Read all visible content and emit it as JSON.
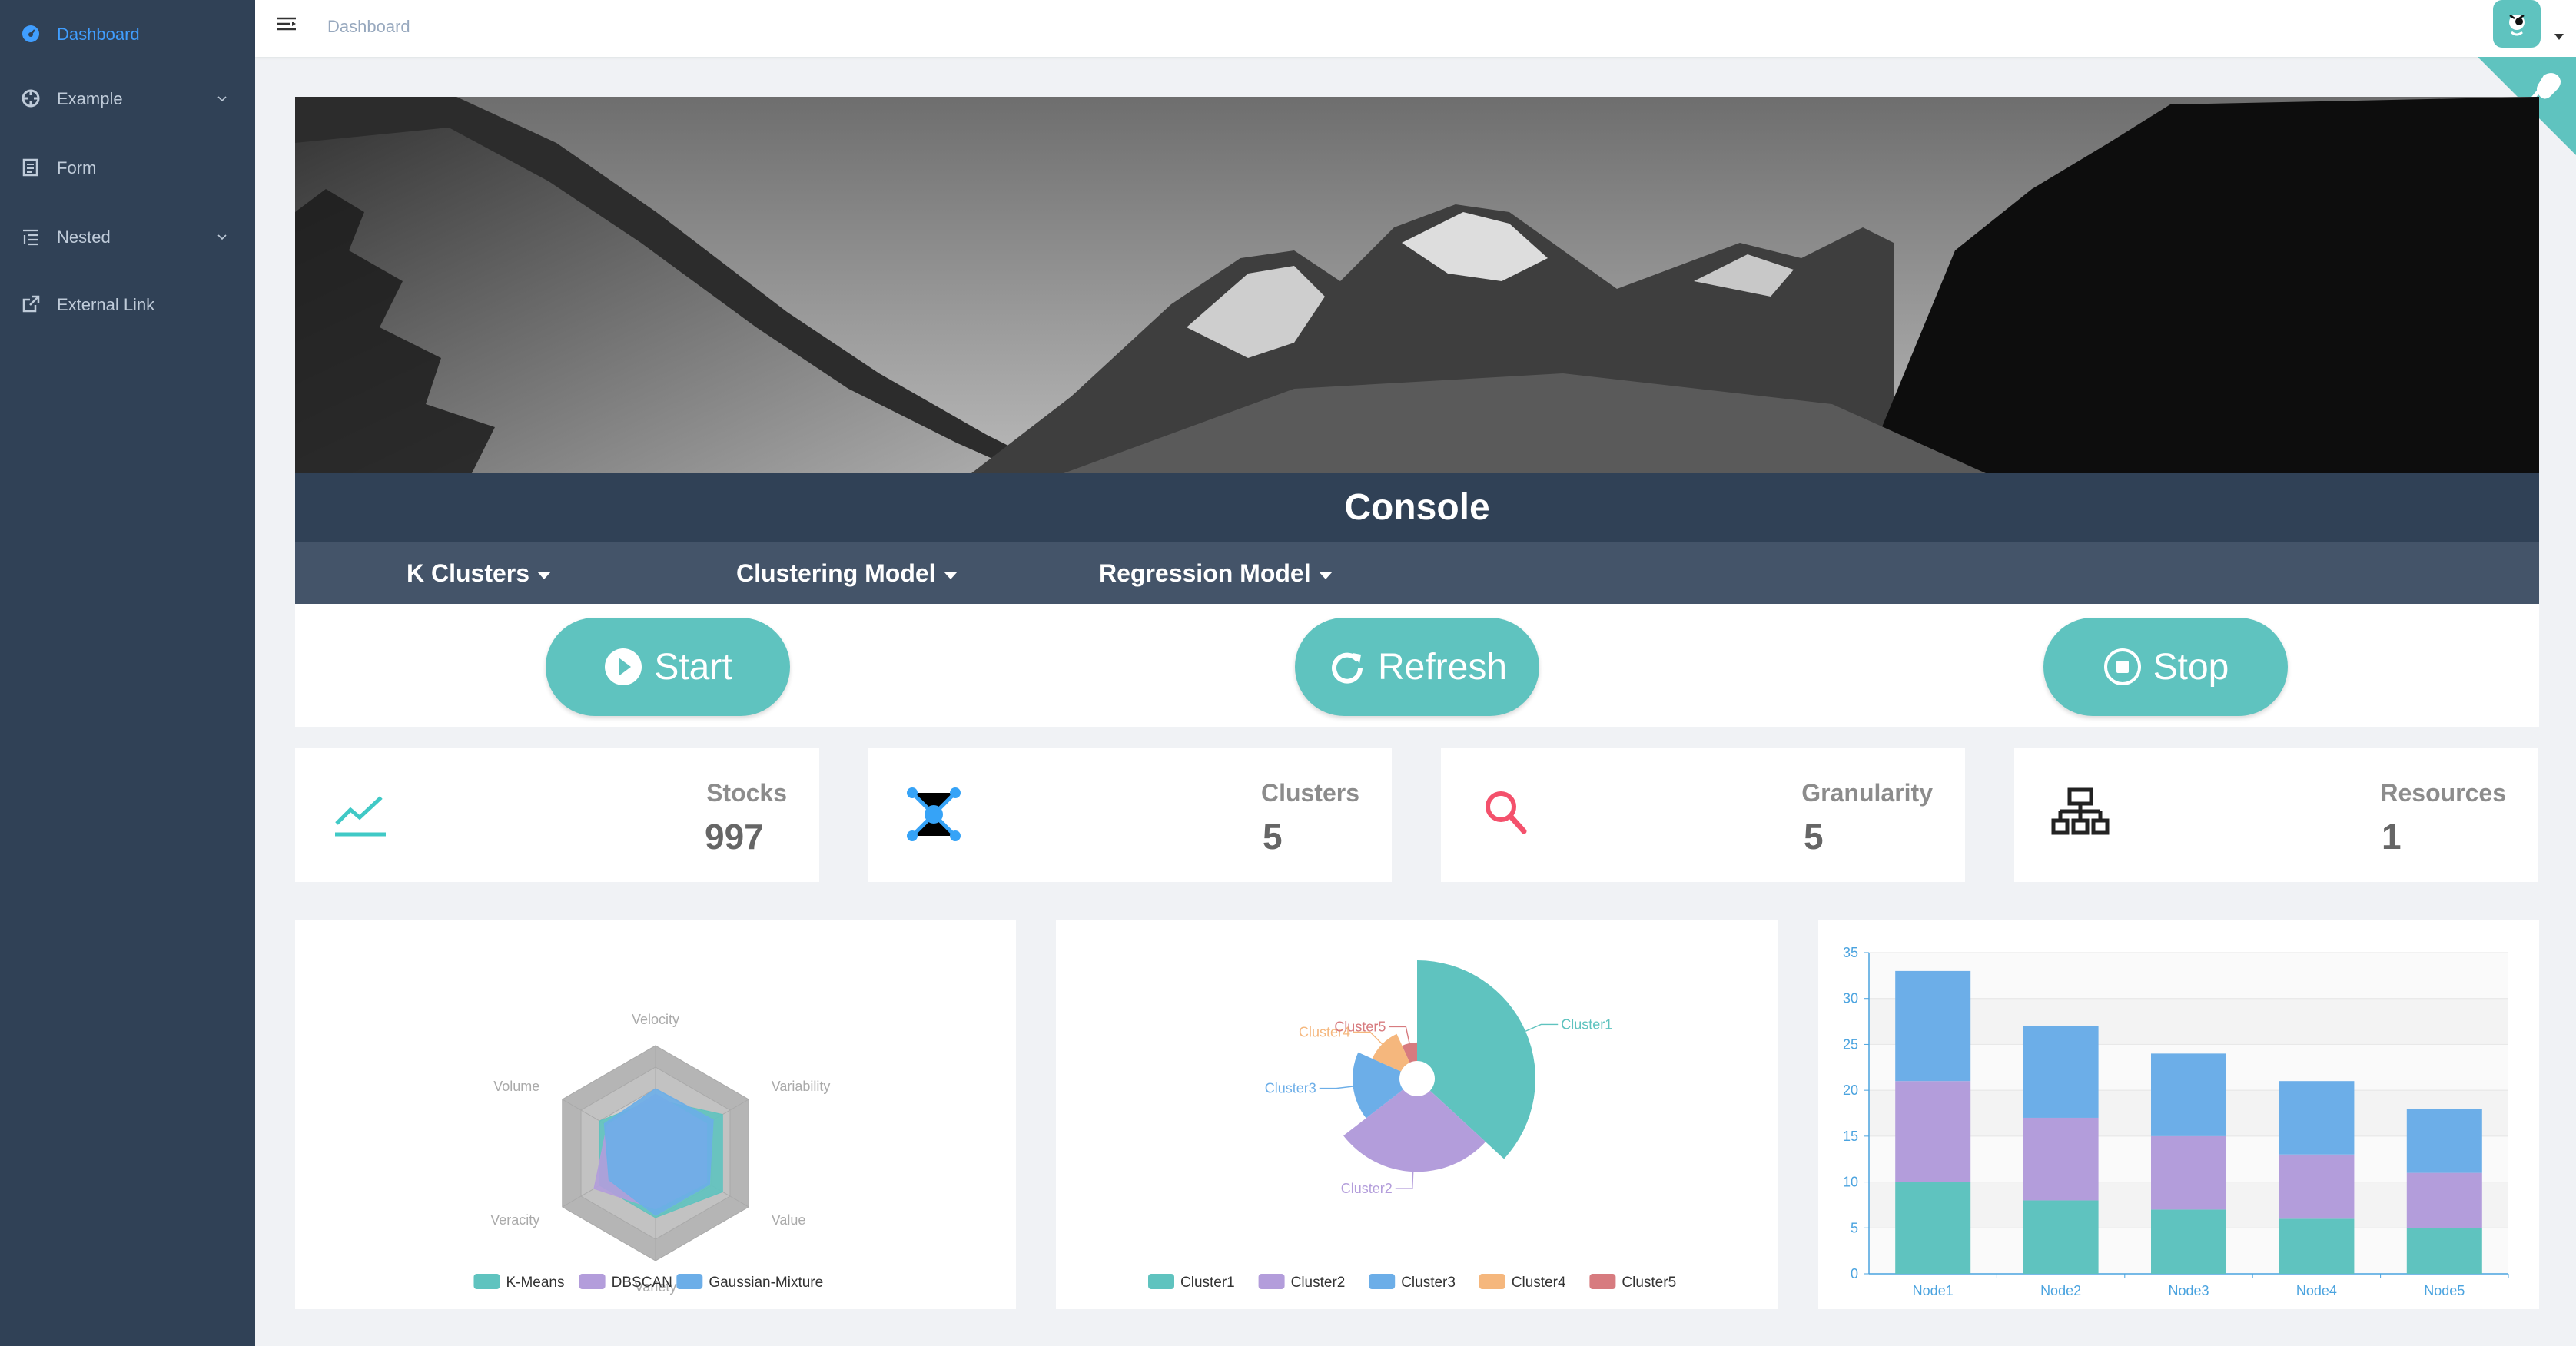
{
  "sidebar": {
    "items": [
      {
        "label": "Dashboard",
        "icon": "dashboard-icon",
        "active": true,
        "has_children": false
      },
      {
        "label": "Example",
        "icon": "example-icon",
        "active": false,
        "has_children": true
      },
      {
        "label": "Form",
        "icon": "form-icon",
        "active": false,
        "has_children": false
      },
      {
        "label": "Nested",
        "icon": "nested-icon",
        "active": false,
        "has_children": true
      },
      {
        "label": "External Link",
        "icon": "external-link-icon",
        "active": false,
        "has_children": false
      }
    ]
  },
  "navbar": {
    "breadcrumb": "Dashboard",
    "avatar_icon": "user-avatar"
  },
  "console": {
    "title": "Console",
    "dropdowns": [
      "K Clusters",
      "Clustering Model",
      "Regression Model"
    ],
    "buttons": {
      "start": "Start",
      "refresh": "Refresh",
      "stop": "Stop"
    }
  },
  "stats": [
    {
      "title": "Stocks",
      "value": "997",
      "icon": "line-chart-icon",
      "color": "#40c9c6"
    },
    {
      "title": "Clusters",
      "value": "5",
      "icon": "network-icon",
      "color": "#36a3f7"
    },
    {
      "title": "Granularity",
      "value": "5",
      "icon": "search-icon",
      "color": "#f4516c"
    },
    {
      "title": "Resources",
      "value": "1",
      "icon": "hierarchy-icon",
      "color": "#34bfa3"
    }
  ],
  "colors": {
    "sidebar": "#304156",
    "accent": "#409eff",
    "teal": "#5fc3bf",
    "console_bar": "#304156",
    "dropdown_bar": "#445469"
  },
  "chart_data": [
    {
      "type": "radar",
      "indicators": [
        "Velocity",
        "Variability",
        "Value",
        "Variety",
        "Veracity",
        "Volume"
      ],
      "max": 100,
      "series": [
        {
          "name": "K-Means",
          "values": [
            50,
            72,
            72,
            60,
            60,
            60
          ],
          "color": "#5fc3bf"
        },
        {
          "name": "DBSCAN",
          "values": [
            55,
            55,
            55,
            52,
            66,
            52
          ],
          "color": "#b39ddb"
        },
        {
          "name": "Gaussian-Mixture",
          "values": [
            60,
            62,
            58,
            58,
            50,
            55
          ],
          "color": "#6caee8"
        }
      ],
      "legend_position": "bottom"
    },
    {
      "type": "pie",
      "roseType": "radius",
      "slices": [
        {
          "name": "Cluster1",
          "value": 320,
          "color": "#5fc3bf"
        },
        {
          "name": "Cluster2",
          "value": 240,
          "color": "#b39ddb"
        },
        {
          "name": "Cluster3",
          "value": 149,
          "color": "#6caee8"
        },
        {
          "name": "Cluster4",
          "value": 100,
          "color": "#f5b77d"
        },
        {
          "name": "Cluster5",
          "value": 59,
          "color": "#d77b7f"
        }
      ],
      "legend_position": "bottom"
    },
    {
      "type": "bar",
      "stacked": true,
      "categories": [
        "Node1",
        "Node2",
        "Node3",
        "Node4",
        "Node5"
      ],
      "ylim": [
        0,
        35
      ],
      "yticks": [
        0,
        5,
        10,
        15,
        20,
        25,
        30,
        35
      ],
      "series": [
        {
          "values": [
            10,
            8,
            7,
            6,
            5
          ],
          "color": "#5fc3bf"
        },
        {
          "values": [
            11,
            9,
            8,
            7,
            6
          ],
          "color": "#b39ddb"
        },
        {
          "values": [
            12,
            10,
            9,
            8,
            7
          ],
          "color": "#6caee8"
        }
      ]
    }
  ]
}
